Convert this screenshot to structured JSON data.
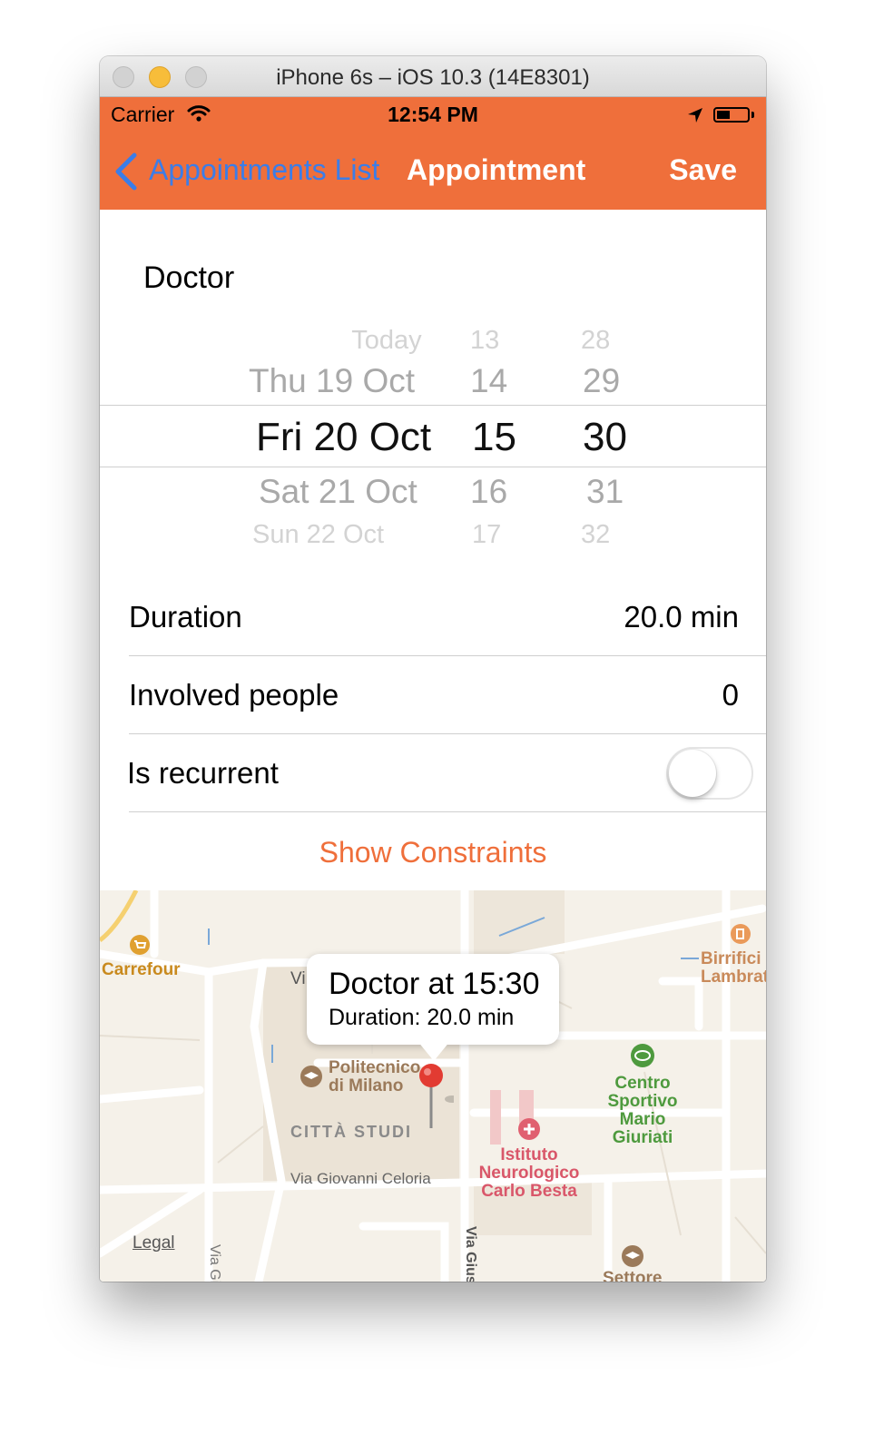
{
  "window": {
    "title": "iPhone 6s – iOS 10.3 (14E8301)"
  },
  "status_bar": {
    "carrier": "Carrier",
    "time": "12:54 PM"
  },
  "nav": {
    "back_label": "Appointments List",
    "title": "Appointment",
    "save_label": "Save"
  },
  "appointment": {
    "title": "Doctor"
  },
  "picker": {
    "dates": [
      "Today",
      "Thu 19 Oct",
      "Fri 20 Oct",
      "Sat 21 Oct",
      "Sun 22 Oct"
    ],
    "hours": [
      "13",
      "14",
      "15",
      "16",
      "17"
    ],
    "minutes": [
      "28",
      "29",
      "30",
      "31",
      "32"
    ],
    "selected_index": 2
  },
  "fields": {
    "duration": {
      "label": "Duration",
      "value": "20.0 min"
    },
    "involved": {
      "label": "Involved people",
      "value": "0"
    },
    "recurrent": {
      "label": "Is recurrent",
      "on": false
    }
  },
  "show_constraints_label": "Show Constraints",
  "map": {
    "callout_title": "Doctor at 15:30",
    "callout_subtitle": "Duration: 20.0 min",
    "labels": {
      "carrefour": "Carrefour",
      "birrificio": "Birrifici\nLambrat",
      "politecnico": "Politecnico\ndi Milano",
      "citta_studi": "CITTÀ STUDI",
      "centro_sportivo": "Centro\nSportivo\nMario\nGiuriati",
      "istituto": "Istituto\nNeurologico\nCarlo Besta",
      "via_celoria": "Via Giovanni Celoria",
      "via_giuse_left": "Via Giuse",
      "via_giuse_right": "Via Giuse",
      "vi": "Vi",
      "settore": "Settore",
      "legal": "Legal"
    },
    "colors": {
      "education": "#9b7a5a",
      "sport": "#4e9a3e",
      "health": "#d9576a",
      "shop": "#e0a030"
    }
  },
  "colors": {
    "accent": "#ef6f3b",
    "link_blue": "#3b7de8"
  }
}
